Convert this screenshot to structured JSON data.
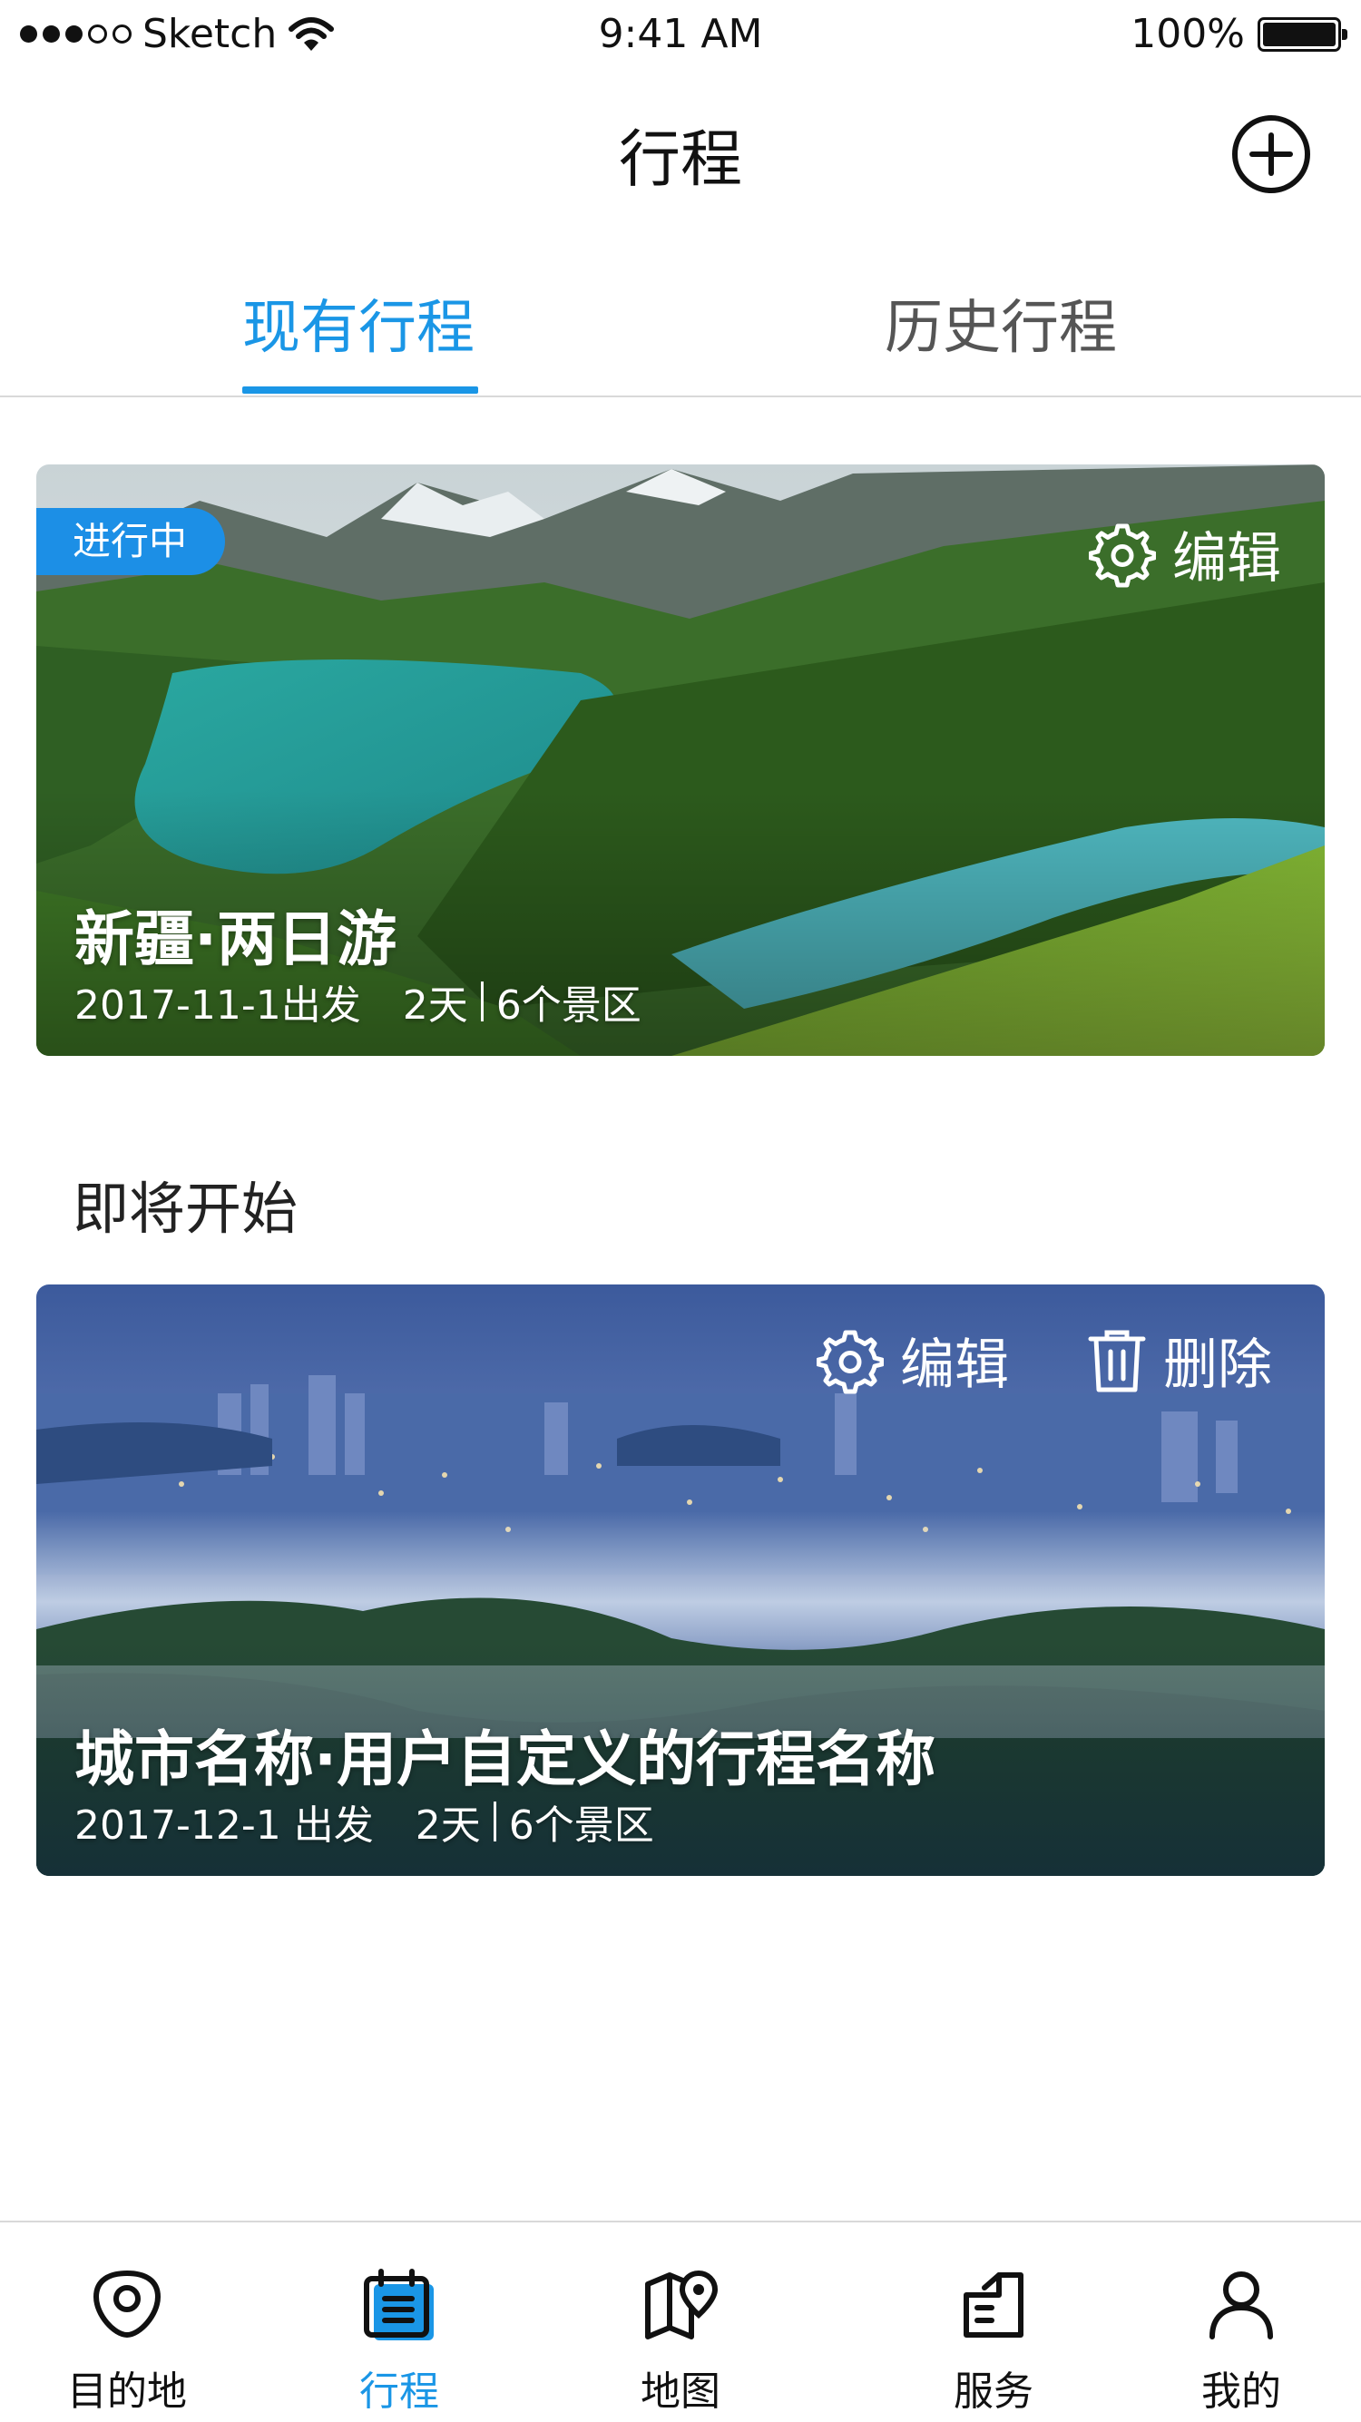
{
  "status_bar": {
    "carrier": "Sketch",
    "time": "9:41 AM",
    "battery": "100%"
  },
  "nav": {
    "title": "行程"
  },
  "tabs": [
    {
      "label": "现有行程",
      "active": true
    },
    {
      "label": "历史行程",
      "active": false
    }
  ],
  "current_trip": {
    "badge": "进行中",
    "edit_label": "编辑",
    "title": "新疆·两日游",
    "date": "2017-11-1出发",
    "days": "2天",
    "spots": "6个景区"
  },
  "upcoming": {
    "section_title": "即将开始",
    "edit_label": "编辑",
    "delete_label": "删除",
    "title": "城市名称·用户自定义的行程名称",
    "date": "2017-12-1 出发",
    "days": "2天",
    "spots": "6个景区"
  },
  "tabbar": {
    "items": [
      {
        "label": "目的地",
        "icon": "destination-icon"
      },
      {
        "label": "行程",
        "icon": "itinerary-icon",
        "active": true
      },
      {
        "label": "地图",
        "icon": "map-icon"
      },
      {
        "label": "服务",
        "icon": "service-icon"
      },
      {
        "label": "我的",
        "icon": "profile-icon"
      }
    ]
  },
  "colors": {
    "accent": "#1a96e6",
    "badge": "#1c8fe6"
  }
}
